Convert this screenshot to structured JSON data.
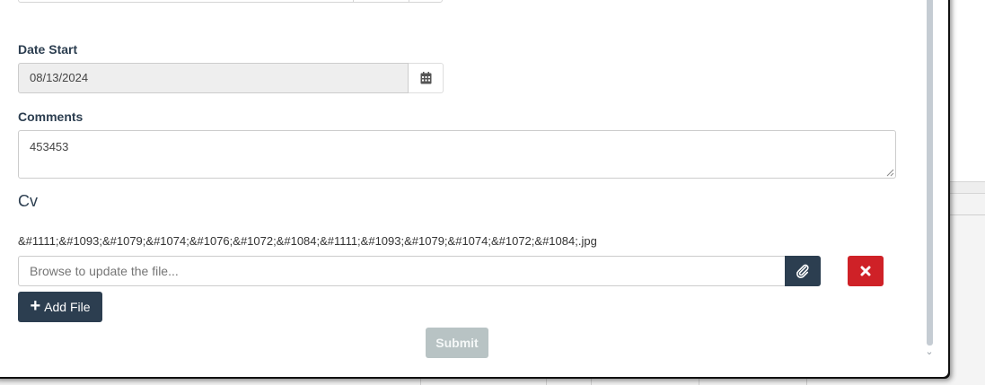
{
  "form": {
    "date_start": {
      "label": "Date Start",
      "value": "08/13/2024",
      "addon_icon": "calendar-icon"
    },
    "comments": {
      "label": "Comments",
      "value": "453453"
    },
    "cv": {
      "heading": "Cv",
      "file_name": "&#1111;&#1093;&#1079;&#1074;&#1076;&#1072;&#1084;&#1111;&#1093;&#1079;&#1074;&#1072;&#1084;.jpg",
      "file_input_placeholder": "Browse to update the file...",
      "attach_icon": "paperclip-icon",
      "remove_icon": "close-icon",
      "add_file_label": "Add File",
      "add_file_icon": "plus-icon"
    },
    "submit_label": "Submit"
  },
  "colors": {
    "primary_dark": "#2c3e50",
    "danger": "#cf2127",
    "disabled": "#b8c3c4",
    "readonly_bg": "#eeeeee"
  }
}
